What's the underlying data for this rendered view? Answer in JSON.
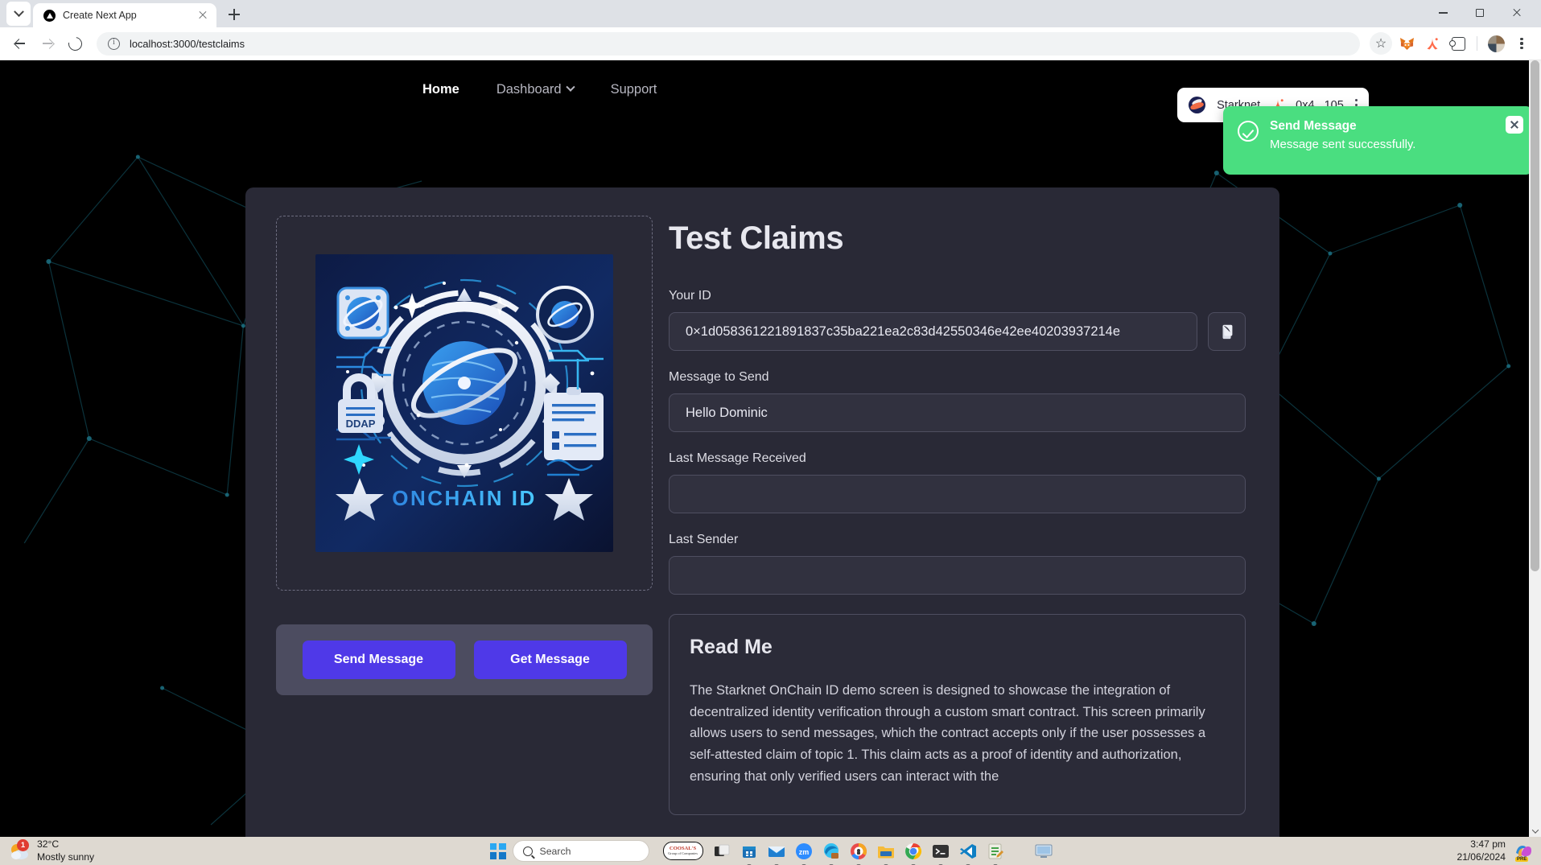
{
  "browser": {
    "tab": {
      "title": "Create Next App",
      "favicon": "nextjs-icon"
    },
    "new_tab_label": "+",
    "url": "localhost:3000/testclaims",
    "toolbar_icons": [
      "bookmark-star-icon",
      "metamask-icon",
      "argent-wallet-icon",
      "extensions-icon",
      "profile-avatar",
      "chrome-menu-icon"
    ],
    "window_controls": [
      "minimize",
      "maximize",
      "close"
    ]
  },
  "nav": {
    "links": [
      {
        "label": "Home",
        "active": true,
        "has_chevron": false
      },
      {
        "label": "Dashboard",
        "active": false,
        "has_chevron": true
      },
      {
        "label": "Support",
        "active": false,
        "has_chevron": false
      }
    ]
  },
  "wallet": {
    "network": "Starknet",
    "address": "0x4...105",
    "menu": "wallet-menu-icon"
  },
  "toast": {
    "title": "Send Message",
    "message": "Message sent successfully.",
    "color": "#4ade80",
    "close_label": "×"
  },
  "image_card": {
    "alt": "ONCHAIN ID",
    "caption": "ONCHAIN ID",
    "badge_label": "DDAP"
  },
  "actions": {
    "send_label": "Send Message",
    "get_label": "Get Message",
    "accent": "#4f39e8"
  },
  "main": {
    "title": "Test Claims",
    "fields": [
      {
        "label": "Your ID",
        "value": "0×1d058361221891837c35ba221ea2c83d42550346e42ee40203937214e",
        "has_copy": true
      },
      {
        "label": "Message to Send",
        "value": "Hello Dominic",
        "has_copy": false
      },
      {
        "label": "Last Message Received",
        "value": "",
        "has_copy": false
      },
      {
        "label": "Last Sender",
        "value": "",
        "has_copy": false
      }
    ],
    "copy_icon": "copy-icon"
  },
  "readme": {
    "heading": "Read Me",
    "body": "The Starknet OnChain ID demo screen is designed to showcase the integration of decentralized identity verification through a custom smart contract. This screen primarily allows users to send messages, which the contract accepts only if the user possesses a self-attested claim of topic 1. This claim acts as a proof of identity and authorization, ensuring that only verified users can interact with the"
  },
  "taskbar": {
    "weather": {
      "temp": "32°C",
      "condition": "Mostly sunny",
      "badge": "1"
    },
    "search_placeholder": "Search",
    "apps": [
      "coosals-widget",
      "task-view-icon",
      "microsoft-store-icon",
      "mail-icon",
      "zoom-icon",
      "edge-icon",
      "password-manager-icon",
      "file-explorer-icon",
      "chrome-icon",
      "terminal-icon",
      "vscode-icon",
      "notepad-icon",
      "remote-desktop-icon"
    ],
    "clock": {
      "time": "3:47 pm",
      "date": "21/06/2024"
    },
    "copilot_label": "PRE"
  }
}
